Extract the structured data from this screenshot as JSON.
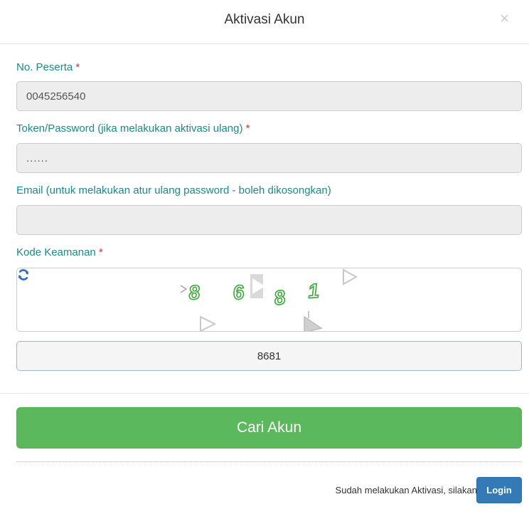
{
  "header": {
    "title": "Aktivasi Akun",
    "close_symbol": "×"
  },
  "form": {
    "participant_no": {
      "label": "No. Peserta",
      "required_mark": "*",
      "value": "0045256540"
    },
    "token": {
      "label": "Token/Password (jika melakukan aktivasi ulang)",
      "required_mark": "*",
      "value": "......"
    },
    "email": {
      "label": "Email (untuk melakukan atur ulang password - boleh dikosongkan)",
      "value": ""
    },
    "security_code": {
      "label": "Kode Keamanan",
      "required_mark": "*",
      "captcha_glyphs": [
        "8",
        "6",
        "8",
        "1"
      ],
      "refresh_icon": "refresh-icon",
      "value": "8681"
    }
  },
  "actions": {
    "submit_label": "Cari Akun",
    "footer_text": "Sudah melakukan Aktivasi, silakan",
    "login_label": "Login"
  },
  "colors": {
    "label": "#1a8a8a",
    "required": "#e03030",
    "primary_button": "#5cb85c",
    "login_button": "#337ab7",
    "captcha_glyph": "#3aa83a"
  }
}
